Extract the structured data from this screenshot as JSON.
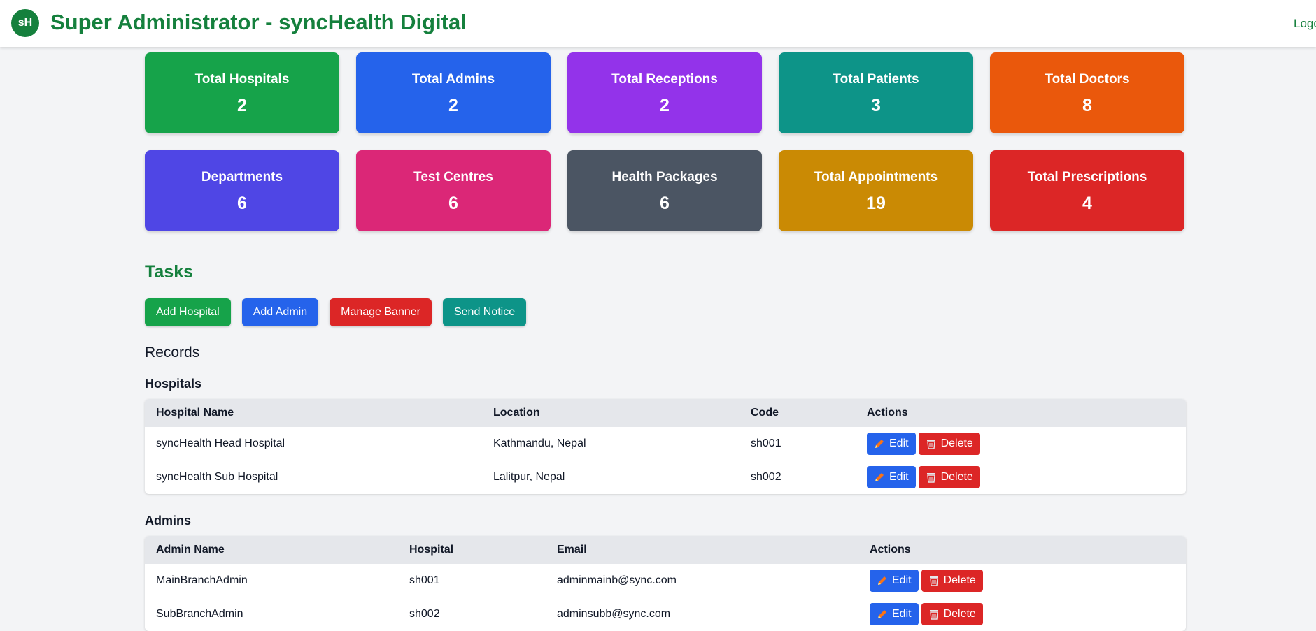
{
  "header": {
    "logo_text": "sH",
    "title": "Super Administrator - syncHealth Digital",
    "logout_label": "Logout"
  },
  "stats": [
    {
      "label": "Total Hospitals",
      "value": "2",
      "color": "#16a34a"
    },
    {
      "label": "Total Admins",
      "value": "2",
      "color": "#2563eb"
    },
    {
      "label": "Total Receptions",
      "value": "2",
      "color": "#9333ea"
    },
    {
      "label": "Total Patients",
      "value": "3",
      "color": "#0d9488"
    },
    {
      "label": "Total Doctors",
      "value": "8",
      "color": "#ea580c"
    },
    {
      "label": "Departments",
      "value": "6",
      "color": "#4f46e5"
    },
    {
      "label": "Test Centres",
      "value": "6",
      "color": "#db2777"
    },
    {
      "label": "Health Packages",
      "value": "6",
      "color": "#4b5563"
    },
    {
      "label": "Total Appointments",
      "value": "19",
      "color": "#ca8a04"
    },
    {
      "label": "Total Prescriptions",
      "value": "4",
      "color": "#dc2626"
    }
  ],
  "tasks": {
    "title": "Tasks",
    "buttons": [
      {
        "label": "Add Hospital",
        "color": "#16a34a"
      },
      {
        "label": "Add Admin",
        "color": "#2563eb"
      },
      {
        "label": "Manage Banner",
        "color": "#dc2626"
      },
      {
        "label": "Send Notice",
        "color": "#0d9488"
      }
    ]
  },
  "records": {
    "title": "Records",
    "hospitals": {
      "title": "Hospitals",
      "columns": [
        "Hospital Name",
        "Location",
        "Code",
        "Actions"
      ],
      "rows": [
        {
          "name": "syncHealth Head Hospital",
          "location": "Kathmandu, Nepal",
          "code": "sh001"
        },
        {
          "name": "syncHealth Sub Hospital",
          "location": "Lalitpur, Nepal",
          "code": "sh002"
        }
      ]
    },
    "admins": {
      "title": "Admins",
      "columns": [
        "Admin Name",
        "Hospital",
        "Email",
        "Actions"
      ],
      "rows": [
        {
          "name": "MainBranchAdmin",
          "hospital": "sh001",
          "email": "adminmainb@sync.com"
        },
        {
          "name": "SubBranchAdmin",
          "hospital": "sh002",
          "email": "adminsubb@sync.com"
        }
      ]
    },
    "actions": {
      "edit_label": "Edit",
      "delete_label": "Delete"
    }
  }
}
